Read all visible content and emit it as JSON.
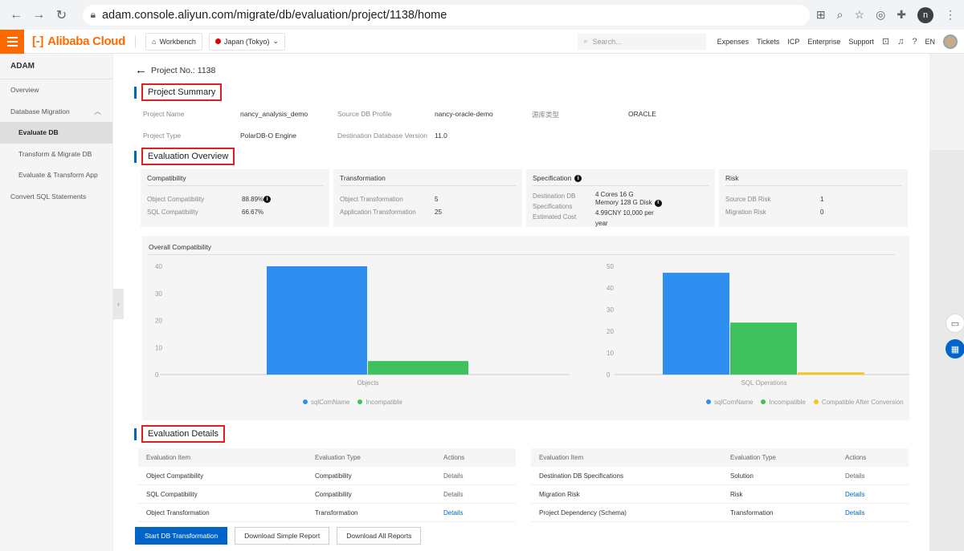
{
  "browser": {
    "url": "adam.console.aliyun.com/migrate/db/evaluation/project/1138/home",
    "profile_initial": "n"
  },
  "topbar": {
    "brand": "Alibaba Cloud",
    "workbench": "Workbench",
    "region": "Japan (Tokyo)",
    "search_placeholder": "Search...",
    "links": [
      "Expenses",
      "Tickets",
      "ICP",
      "Enterprise",
      "Support"
    ],
    "lang": "EN",
    "brand_color": "#ff6a00"
  },
  "sidebar": {
    "title": "ADAM",
    "items": [
      {
        "label": "Overview"
      },
      {
        "label": "Database Migration"
      },
      {
        "label": "Evaluate DB"
      },
      {
        "label": "Transform & Migrate DB"
      },
      {
        "label": "Evaluate & Transform App"
      },
      {
        "label": "Convert SQL Statements"
      }
    ]
  },
  "page": {
    "back_label": "Project No.: 1138"
  },
  "summary": {
    "title": "Project Summary",
    "project_name_label": "Project Name",
    "project_name": "nancy_analysis_demo",
    "source_profile_label": "Source DB Profile",
    "source_profile": "nancy-oracle-demo",
    "source_type_label": "源库类型",
    "source_type": "ORACLE",
    "project_type_label": "Project Type",
    "project_type": "PolarDB-O Engine",
    "dest_version_label": "Destination Database Version",
    "dest_version": "11.0"
  },
  "overview": {
    "title": "Evaluation Overview",
    "compat": {
      "title": "Compatibility",
      "object_label": "Object Compatibility",
      "object_value": "88.89%",
      "sql_label": "SQL Compatibility",
      "sql_value": "66.67%"
    },
    "transform": {
      "title": "Transformation",
      "object_label": "Object Transformation",
      "object_value": "5",
      "app_label": "Application Transformation",
      "app_value": "25"
    },
    "spec": {
      "title": "Specification",
      "dest_label": "Destination DB",
      "dest_label2": "Specifications",
      "dest_value1": "4 Cores 16 G",
      "dest_value2": "Memory 128 G Disk",
      "cost_label": "Estimated Cost",
      "cost_value1": "4.99CNY 10,000 per",
      "cost_value2": "year"
    },
    "risk": {
      "title": "Risk",
      "source_label": "Source DB Risk",
      "source_value": "1",
      "migration_label": "Migration Risk",
      "migration_value": "0"
    }
  },
  "chart_panel_title": "Overall Compatibility",
  "chart_data": [
    {
      "type": "bar",
      "categories": [
        "Objects"
      ],
      "series": [
        {
          "name": "sqlComName",
          "values": [
            40
          ],
          "color": "#2f8ff0"
        },
        {
          "name": "Incompatible",
          "values": [
            5
          ],
          "color": "#3fc25e"
        }
      ],
      "ylim": [
        0,
        40
      ],
      "yticks": [
        "40",
        "30",
        "20",
        "10",
        "0"
      ],
      "grid": false,
      "legend": "bottom"
    },
    {
      "type": "bar",
      "categories": [
        "SQL Operations"
      ],
      "series": [
        {
          "name": "sqlComName",
          "values": [
            47
          ],
          "color": "#2f8ff0"
        },
        {
          "name": "Incompatible",
          "values": [
            24
          ],
          "color": "#3fc25e"
        },
        {
          "name": "Compatible After Conversion",
          "values": [
            1
          ],
          "color": "#f5c518"
        }
      ],
      "ylim": [
        0,
        50
      ],
      "yticks": [
        "50",
        "40",
        "30",
        "20",
        "10",
        "0"
      ],
      "grid": false,
      "legend": "bottom"
    }
  ],
  "details": {
    "title": "Evaluation Details",
    "headers": [
      "Evaluation Item",
      "Evaluation Type",
      "Actions"
    ],
    "left_rows": [
      {
        "item": "Object Compatibility",
        "type": "Compatibility",
        "action": "Details"
      },
      {
        "item": "SQL Compatibility",
        "type": "Compatibility",
        "action": "Details"
      },
      {
        "item": "Object Transformation",
        "type": "Transformation",
        "action": "Details"
      }
    ],
    "right_rows": [
      {
        "item": "Destination DB Specifications",
        "type": "Solution",
        "action": "Details"
      },
      {
        "item": "Migration Risk",
        "type": "Risk",
        "action": "Details"
      },
      {
        "item": "Project Dependency (Schema)",
        "type": "Transformation",
        "action": "Details"
      }
    ]
  },
  "buttons": {
    "start": "Start DB Transformation",
    "simple": "Download Simple Report",
    "all": "Download All Reports"
  }
}
